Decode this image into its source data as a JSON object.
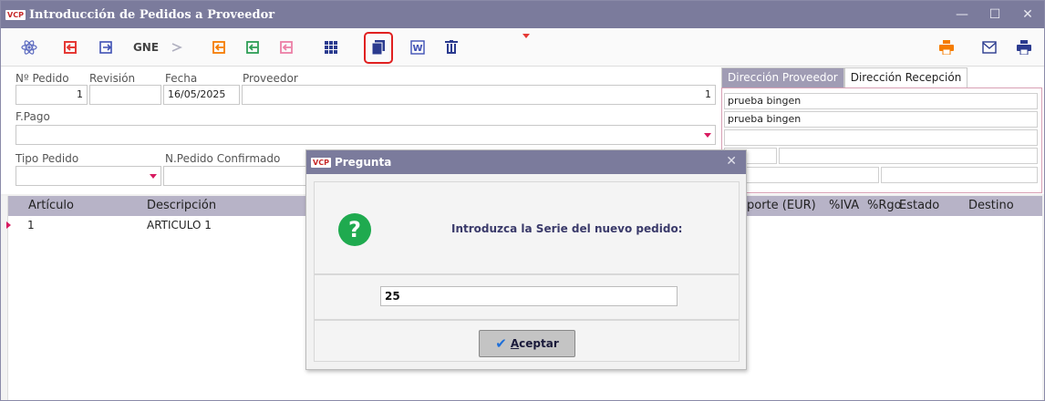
{
  "window": {
    "app_badge": "VCP",
    "title": "Introducción de Pedidos a Proveedor",
    "controls": [
      "—",
      "☐",
      "✕"
    ]
  },
  "toolbar": {
    "gne_label": "GNE",
    "icons": [
      "atom-icon",
      "import-icon",
      "export-icon",
      "gne-label",
      "arrow-right-icon",
      "import-orange-icon",
      "import-green-icon",
      "import-pink-icon",
      "grid-icon",
      "copy-icon",
      "word-icon",
      "delete-icon",
      "printer-orange-icon",
      "mail-icon",
      "printer-icon"
    ]
  },
  "form": {
    "labels": {
      "numero": "Nº Pedido",
      "revision": "Revisión",
      "fecha": "Fecha",
      "proveedor": "Proveedor",
      "fpago": "F.Pago",
      "tipo": "Tipo Pedido",
      "npedido": "N.Pedido Confirmado"
    },
    "values": {
      "numero": "1",
      "revision": "",
      "fecha": "16/05/2025",
      "proveedor": "1",
      "fpago": "",
      "tipo": "",
      "npedido": ""
    }
  },
  "address": {
    "tabs": [
      "Dirección Proveedor",
      "Dirección Recepción"
    ],
    "line1": "prueba bingen",
    "line2": "prueba bingen",
    "line3": "",
    "line4a": "",
    "line4b": "",
    "line5a": "",
    "line5b": ""
  },
  "grid": {
    "columns": [
      "Artículo",
      "Descripción",
      "porte (EUR)",
      "%IVA",
      "%Rgo",
      "Estado",
      "Destino"
    ],
    "rows": [
      {
        "articulo": "1",
        "descripcion": "ARTICULO 1"
      }
    ]
  },
  "dialog": {
    "badge": "VCP",
    "title": "Pregunta",
    "close": "✕",
    "question_icon": "?",
    "question": "Introduzca la Serie del nuevo pedido:",
    "serie_value": "25",
    "accept_underlined": "A",
    "accept_rest": "ceptar"
  },
  "colors": {
    "titlebar": "#7b7b9c",
    "accent_pink": "#d81b60",
    "question_green": "#1faa4f",
    "highlight_red": "#e02020"
  }
}
